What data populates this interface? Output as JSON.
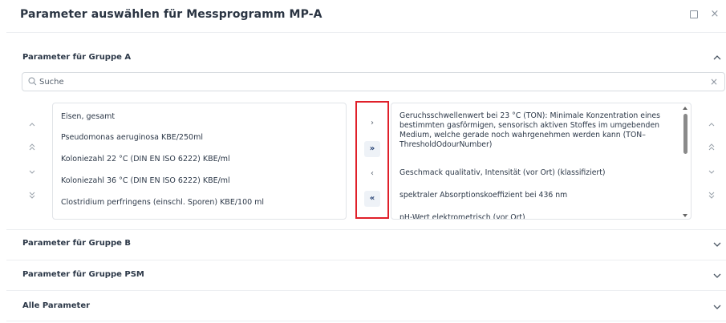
{
  "dialog": {
    "title": "Parameter auswählen für Messprogramm MP-A",
    "expand_icon": "expand-icon",
    "close_glyph": "×"
  },
  "sections": {
    "group_a": {
      "label": "Parameter für Gruppe A",
      "state": "expanded"
    },
    "group_b": {
      "label": "Parameter für Gruppe B",
      "state": "collapsed"
    },
    "group_psm": {
      "label": "Parameter für Gruppe PSM",
      "state": "collapsed"
    },
    "all": {
      "label": "Alle Parameter",
      "state": "collapsed"
    }
  },
  "search": {
    "placeholder": "Suche",
    "value": "",
    "clear_glyph": "×"
  },
  "available_list": {
    "items": [
      "Eisen, gesamt",
      "Pseudomonas aeruginosa KBE/250ml",
      "Koloniezahl 22 °C (DIN EN ISO 6222) KBE/ml",
      "Koloniezahl 36 °C (DIN EN ISO 6222) KBE/ml",
      "Clostridium perfringens (einschl. Sporen) KBE/100 ml"
    ]
  },
  "selected_list": {
    "items": [
      "Geruchsschwellenwert bei 23 °C (TON): Minimale Konzentration eines bestimmten gasförmigen, sensorisch aktiven Stoffes im umgebenden Medium, welche gerade noch wahrgenehmen werden kann (TON–ThresholdOdourNumber)",
      "Geschmack qualitativ, Intensität (vor Ort) (klassifiziert)",
      "spektraler Absorptionskoeffizient bei 436 nm",
      "pH-Wert elektrometrisch (vor Ort)"
    ]
  },
  "transfer_buttons": {
    "move_right": "›",
    "move_all_right": "»",
    "move_left": "‹",
    "move_all_left": "«"
  },
  "order_buttons": {
    "up": "⌃",
    "top": "⌃⌃",
    "down": "⌄",
    "bottom": "⌄⌄"
  },
  "colors": {
    "highlight_border": "#e0202a",
    "text": "#2c3848",
    "active_button_text": "#1e3a6e"
  }
}
